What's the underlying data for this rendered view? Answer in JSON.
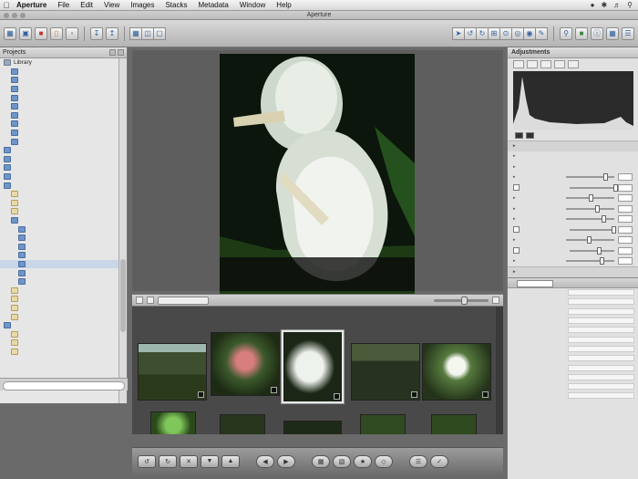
{
  "menubar": {
    "app": "Aperture",
    "items": [
      "File",
      "Edit",
      "View",
      "Images",
      "Stacks",
      "Metadata",
      "Window",
      "Help"
    ]
  },
  "window": {
    "title": "Aperture"
  },
  "library": {
    "header": "Projects",
    "search_placeholder": "",
    "items": [
      {
        "label": "Library",
        "icon": "gray",
        "indent": 0
      },
      {
        "label": "",
        "icon": "blue",
        "indent": 1
      },
      {
        "label": "",
        "icon": "blue",
        "indent": 1
      },
      {
        "label": "",
        "icon": "blue",
        "indent": 1
      },
      {
        "label": "",
        "icon": "blue",
        "indent": 1
      },
      {
        "label": "",
        "icon": "blue",
        "indent": 1
      },
      {
        "label": "",
        "icon": "blue",
        "indent": 1
      },
      {
        "label": "",
        "icon": "blue",
        "indent": 1
      },
      {
        "label": "",
        "icon": "blue",
        "indent": 1
      },
      {
        "label": "",
        "icon": "blue",
        "indent": 1
      },
      {
        "label": "",
        "icon": "blue",
        "indent": 0
      },
      {
        "label": "",
        "icon": "blue",
        "indent": 0
      },
      {
        "label": "",
        "icon": "blue",
        "indent": 0
      },
      {
        "label": "",
        "icon": "blue",
        "indent": 0
      },
      {
        "label": "",
        "icon": "blue",
        "indent": 0
      },
      {
        "label": "",
        "icon": "folder",
        "indent": 1
      },
      {
        "label": "",
        "icon": "folder",
        "indent": 1
      },
      {
        "label": "",
        "icon": "folder",
        "indent": 1
      },
      {
        "label": "",
        "icon": "blue",
        "indent": 1
      },
      {
        "label": "",
        "icon": "blue",
        "indent": 2
      },
      {
        "label": "",
        "icon": "blue",
        "indent": 2
      },
      {
        "label": "",
        "icon": "blue",
        "indent": 2
      },
      {
        "label": "",
        "icon": "blue",
        "indent": 2
      },
      {
        "label": "",
        "icon": "blue",
        "indent": 2
      },
      {
        "label": "",
        "icon": "blue",
        "indent": 2
      },
      {
        "label": "",
        "icon": "blue",
        "indent": 2
      },
      {
        "label": "",
        "icon": "folder",
        "indent": 1
      },
      {
        "label": "",
        "icon": "folder",
        "indent": 1
      },
      {
        "label": "",
        "icon": "folder",
        "indent": 1
      },
      {
        "label": "",
        "icon": "folder",
        "indent": 1
      },
      {
        "label": "",
        "icon": "blue",
        "indent": 0
      },
      {
        "label": "",
        "icon": "folder",
        "indent": 1
      },
      {
        "label": "",
        "icon": "folder",
        "indent": 1
      },
      {
        "label": "",
        "icon": "folder",
        "indent": 1
      }
    ],
    "selected_index": 23
  },
  "viewer": {
    "row1_left": "",
    "row1_center": "",
    "row1_right": "",
    "row2": "",
    "row3": ""
  },
  "browser": {
    "sort_label": "",
    "stack_label": "",
    "selected_index": 2
  },
  "adjustments": {
    "header": "Adjustments",
    "rows": [
      {
        "label": "",
        "type": "section"
      },
      {
        "label": "",
        "type": "plain"
      },
      {
        "label": "",
        "type": "plain"
      },
      {
        "label": "",
        "type": "slider"
      },
      {
        "label": "",
        "type": "check"
      },
      {
        "label": "",
        "type": "slider"
      },
      {
        "label": "",
        "type": "slider"
      },
      {
        "label": "",
        "type": "slider"
      },
      {
        "label": "",
        "type": "check"
      },
      {
        "label": "",
        "type": "slider"
      },
      {
        "label": "",
        "type": "check"
      },
      {
        "label": "",
        "type": "slider"
      },
      {
        "label": "",
        "type": "section"
      }
    ]
  },
  "metadata": {
    "header": "",
    "rows": [
      {
        "k": "",
        "v": ""
      },
      {
        "k": "",
        "v": ""
      },
      {
        "k": "",
        "v": ""
      },
      {
        "k": "",
        "v": ""
      },
      {
        "k": "",
        "v": ""
      },
      {
        "k": "",
        "v": ""
      },
      {
        "k": "",
        "v": ""
      },
      {
        "k": "",
        "v": ""
      },
      {
        "k": "",
        "v": ""
      },
      {
        "k": "",
        "v": ""
      },
      {
        "k": "",
        "v": ""
      },
      {
        "k": "",
        "v": ""
      }
    ]
  },
  "colors": {
    "accent": "#2f5f9e",
    "selection": "#c9d6e8",
    "viewer_bg": "#5e5e5e",
    "browser_bg": "#494949"
  }
}
